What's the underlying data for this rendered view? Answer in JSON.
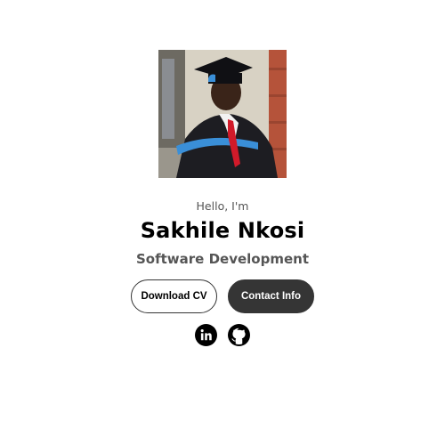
{
  "profile": {
    "photo_alt": "graduation-portrait",
    "greeting": "Hello, I'm",
    "name": "Sakhile Nkosi",
    "role": "Software Development"
  },
  "actions": {
    "download_cv_label": "Download CV",
    "contact_info_label": "Contact Info"
  },
  "socials": [
    {
      "icon": "linkedin-icon"
    },
    {
      "icon": "github-icon"
    }
  ],
  "colors": {
    "background": "#ffffff",
    "button_dark": "#353535",
    "text_muted": "#555555"
  }
}
